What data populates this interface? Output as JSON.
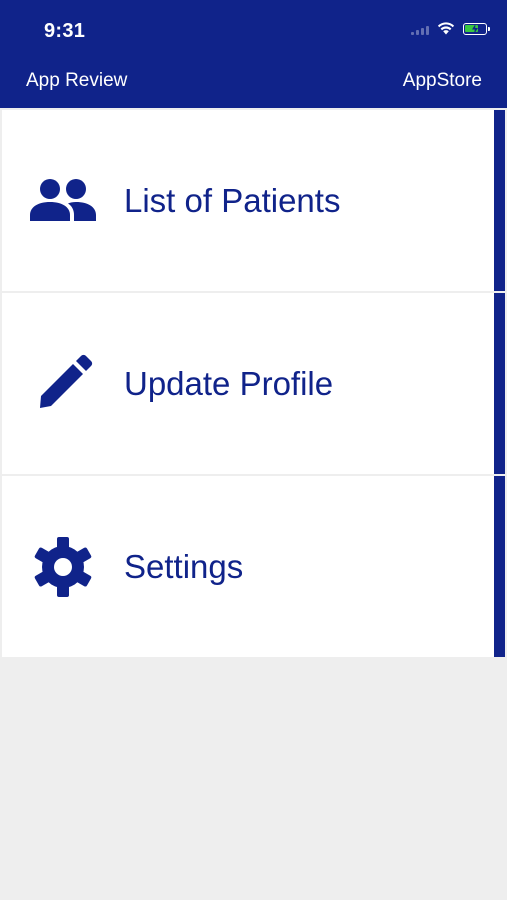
{
  "status_bar": {
    "time": "9:31",
    "battery_level": 0.7,
    "icons": [
      "signal-icon",
      "wifi-icon",
      "battery-charging-icon"
    ]
  },
  "nav": {
    "left_label": "App Review",
    "right_label": "AppStore"
  },
  "menu": {
    "items": [
      {
        "label": "List of Patients",
        "icon": "patients-icon"
      },
      {
        "label": "Update Profile",
        "icon": "pencil-icon"
      },
      {
        "label": "Settings",
        "icon": "gear-icon"
      }
    ]
  },
  "colors": {
    "primary": "#10238a",
    "background": "#eeeeee",
    "card": "#ffffff",
    "battery": "#38c840"
  }
}
